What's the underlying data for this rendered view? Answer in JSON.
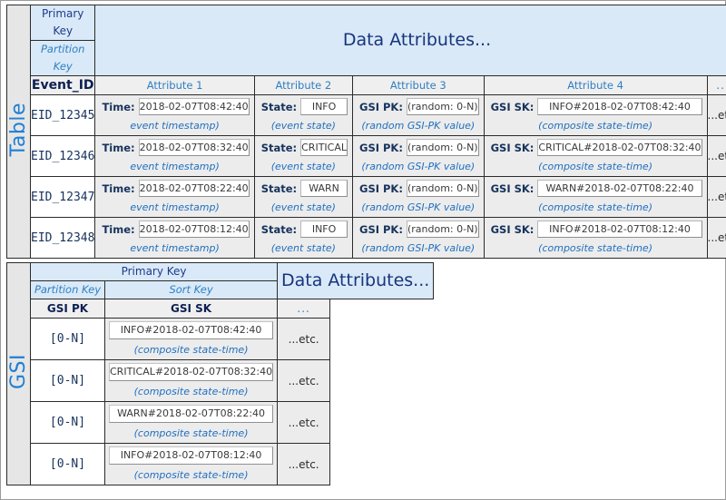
{
  "table_section": {
    "side_label": "Table",
    "headers": {
      "primary_key": "Primary Key",
      "partition_key": "Partition Key",
      "data_attributes": "Data Attributes...",
      "pk_column": "Event_ID",
      "attribute_1": "Attribute 1",
      "attribute_2": "Attribute 2",
      "attribute_3": "Attribute 3",
      "attribute_4": "Attribute 4",
      "more": "..."
    },
    "labels": {
      "time": "Time:",
      "state": "State:",
      "gsi_pk": "GSI PK:",
      "gsi_sk": "GSI SK:"
    },
    "captions": {
      "time": "event timestamp)",
      "state": "(event state)",
      "gsi_pk": "(random GSI-PK value)",
      "gsi_sk": "(composite state-time)"
    },
    "etc": "...etc.",
    "rows": [
      {
        "event_id": "EID_12345",
        "time": "2018-02-07T08:42:40",
        "state": "INFO",
        "gsi_pk": "(random: 0-N)",
        "gsi_sk": "INFO#2018-02-07T08:42:40"
      },
      {
        "event_id": "EID_12346",
        "time": "2018-02-07T08:32:40",
        "state": "CRITICAL",
        "gsi_pk": "(random: 0-N)",
        "gsi_sk": "CRITICAL#2018-02-07T08:32:40"
      },
      {
        "event_id": "EID_12347",
        "time": "2018-02-07T08:22:40",
        "state": "WARN",
        "gsi_pk": "(random: 0-N)",
        "gsi_sk": "WARN#2018-02-07T08:22:40"
      },
      {
        "event_id": "EID_12348",
        "time": "2018-02-07T08:12:40",
        "state": "INFO",
        "gsi_pk": "(random: 0-N)",
        "gsi_sk": "INFO#2018-02-07T08:12:40"
      }
    ]
  },
  "gsi_section": {
    "side_label": "GSI",
    "headers": {
      "primary_key": "Primary Key",
      "partition_key": "Partition Key",
      "sort_key": "Sort Key",
      "data_attributes": "Data Attributes...",
      "pk_column": "GSI PK",
      "sk_column": "GSI SK",
      "more": "..."
    },
    "caption": "(composite state-time)",
    "etc": "...etc.",
    "rows": [
      {
        "gsi_pk": "[0-N]",
        "gsi_sk": "INFO#2018-02-07T08:42:40"
      },
      {
        "gsi_pk": "[0-N]",
        "gsi_sk": "CRITICAL#2018-02-07T08:32:40"
      },
      {
        "gsi_pk": "[0-N]",
        "gsi_sk": "WARN#2018-02-07T08:22:40"
      },
      {
        "gsi_pk": "[0-N]",
        "gsi_sk": "INFO#2018-02-07T08:12:40"
      }
    ]
  },
  "colors": {
    "header_blue_bg": "#d9e9f7",
    "header_blue_text": "#17357e",
    "accent_blue": "#1f7fd4",
    "caption_blue": "#1f6fbf",
    "cell_grey": "#ececec",
    "header_grey": "#efefef",
    "side_grey": "#e6e6e6",
    "border": "#2b2b2b"
  }
}
